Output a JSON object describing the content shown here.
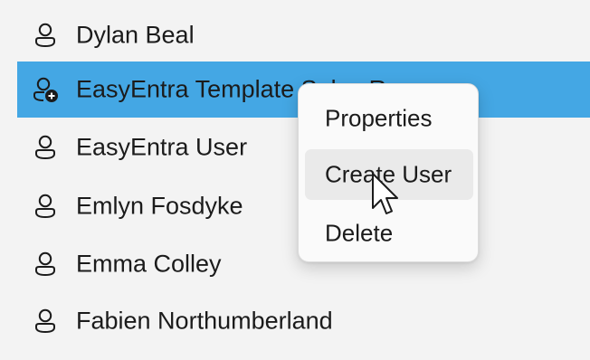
{
  "users": [
    {
      "name": "Dylan Beal",
      "icon": "user-icon"
    },
    {
      "name": "EasyEntra Template Sales Rep",
      "icon": "user-add-icon",
      "selected": true
    },
    {
      "name": "EasyEntra User",
      "icon": "user-icon"
    },
    {
      "name": "Emlyn Fosdyke",
      "icon": "user-icon"
    },
    {
      "name": "Emma Colley",
      "icon": "user-icon"
    },
    {
      "name": "Fabien Northumberland",
      "icon": "user-icon"
    }
  ],
  "context_menu": {
    "items": [
      {
        "label": "Properties"
      },
      {
        "label": "Create User",
        "hovered": true
      },
      {
        "label": "Delete"
      }
    ]
  },
  "colors": {
    "background": "#f3f3f3",
    "selection": "#44a7e4",
    "text": "#1b1b1b",
    "menu_hover": "#eaeaea"
  },
  "cursor": "arrow-pointer-icon"
}
